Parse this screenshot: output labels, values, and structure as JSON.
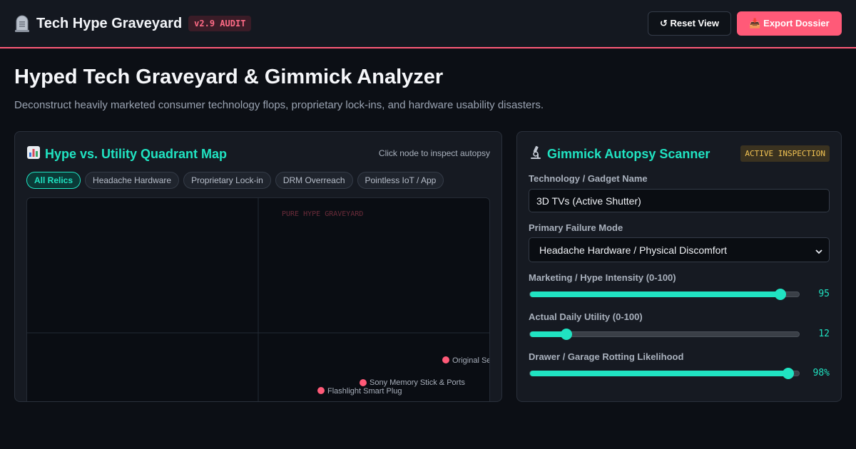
{
  "header": {
    "app_title": "Tech Hype Graveyard",
    "version_badge": "v2.9 AUDIT",
    "reset_label": "↺ Reset View",
    "export_label": "📥 Export Dossier"
  },
  "page": {
    "title": "Hyped Tech Graveyard & Gimmick Analyzer",
    "subtitle": "Deconstruct heavily marketed consumer technology flops, proprietary lock-ins, and hardware usability disasters."
  },
  "quadrant_panel": {
    "title": "Hype vs. Utility Quadrant Map",
    "hint": "Click node to inspect autopsy",
    "filters": [
      {
        "label": "All Relics",
        "active": true
      },
      {
        "label": "Headache Hardware",
        "active": false
      },
      {
        "label": "Proprietary Lock-in",
        "active": false
      },
      {
        "label": "DRM Overreach",
        "active": false
      },
      {
        "label": "Pointless IoT / App",
        "active": false
      }
    ],
    "quadrant_label": "PURE HYPE GRAVEYARD",
    "nodes": [
      {
        "label": "Original Se",
        "color": "#ff5a78"
      },
      {
        "label": "Sony Memory Stick & Ports",
        "color": "#ff5a78"
      },
      {
        "label": "Flashlight Smart Plug",
        "color": "#ff5a78"
      }
    ]
  },
  "scanner_panel": {
    "title": "Gimmick Autopsy Scanner",
    "status_badge": "ACTIVE INSPECTION",
    "name_label": "Technology / Gadget Name",
    "name_value": "3D TVs (Active Shutter)",
    "failure_label": "Primary Failure Mode",
    "failure_value": "Headache Hardware / Physical Discomfort",
    "sliders": [
      {
        "label": "Marketing / Hype Intensity (0-100)",
        "value": 95,
        "display": "95"
      },
      {
        "label": "Actual Daily Utility (0-100)",
        "value": 12,
        "display": "12"
      },
      {
        "label": "Drawer / Garage Rotting Likelihood",
        "value": 98,
        "display": "98%"
      }
    ]
  },
  "colors": {
    "accent_teal": "#20e3c2",
    "accent_pink": "#ff5a78",
    "badge_yellow": "#f3c454"
  }
}
